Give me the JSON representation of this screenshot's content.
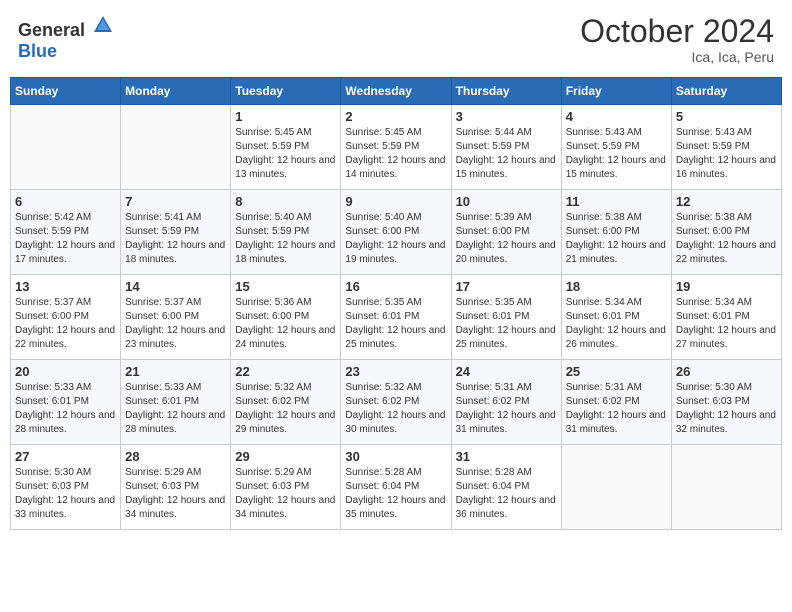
{
  "header": {
    "logo_general": "General",
    "logo_blue": "Blue",
    "month_year": "October 2024",
    "location": "Ica, Ica, Peru"
  },
  "weekdays": [
    "Sunday",
    "Monday",
    "Tuesday",
    "Wednesday",
    "Thursday",
    "Friday",
    "Saturday"
  ],
  "weeks": [
    [
      {
        "day": "",
        "sunrise": "",
        "sunset": "",
        "daylight": ""
      },
      {
        "day": "",
        "sunrise": "",
        "sunset": "",
        "daylight": ""
      },
      {
        "day": "1",
        "sunrise": "Sunrise: 5:45 AM",
        "sunset": "Sunset: 5:59 PM",
        "daylight": "Daylight: 12 hours and 13 minutes."
      },
      {
        "day": "2",
        "sunrise": "Sunrise: 5:45 AM",
        "sunset": "Sunset: 5:59 PM",
        "daylight": "Daylight: 12 hours and 14 minutes."
      },
      {
        "day": "3",
        "sunrise": "Sunrise: 5:44 AM",
        "sunset": "Sunset: 5:59 PM",
        "daylight": "Daylight: 12 hours and 15 minutes."
      },
      {
        "day": "4",
        "sunrise": "Sunrise: 5:43 AM",
        "sunset": "Sunset: 5:59 PM",
        "daylight": "Daylight: 12 hours and 15 minutes."
      },
      {
        "day": "5",
        "sunrise": "Sunrise: 5:43 AM",
        "sunset": "Sunset: 5:59 PM",
        "daylight": "Daylight: 12 hours and 16 minutes."
      }
    ],
    [
      {
        "day": "6",
        "sunrise": "Sunrise: 5:42 AM",
        "sunset": "Sunset: 5:59 PM",
        "daylight": "Daylight: 12 hours and 17 minutes."
      },
      {
        "day": "7",
        "sunrise": "Sunrise: 5:41 AM",
        "sunset": "Sunset: 5:59 PM",
        "daylight": "Daylight: 12 hours and 18 minutes."
      },
      {
        "day": "8",
        "sunrise": "Sunrise: 5:40 AM",
        "sunset": "Sunset: 5:59 PM",
        "daylight": "Daylight: 12 hours and 18 minutes."
      },
      {
        "day": "9",
        "sunrise": "Sunrise: 5:40 AM",
        "sunset": "Sunset: 6:00 PM",
        "daylight": "Daylight: 12 hours and 19 minutes."
      },
      {
        "day": "10",
        "sunrise": "Sunrise: 5:39 AM",
        "sunset": "Sunset: 6:00 PM",
        "daylight": "Daylight: 12 hours and 20 minutes."
      },
      {
        "day": "11",
        "sunrise": "Sunrise: 5:38 AM",
        "sunset": "Sunset: 6:00 PM",
        "daylight": "Daylight: 12 hours and 21 minutes."
      },
      {
        "day": "12",
        "sunrise": "Sunrise: 5:38 AM",
        "sunset": "Sunset: 6:00 PM",
        "daylight": "Daylight: 12 hours and 22 minutes."
      }
    ],
    [
      {
        "day": "13",
        "sunrise": "Sunrise: 5:37 AM",
        "sunset": "Sunset: 6:00 PM",
        "daylight": "Daylight: 12 hours and 22 minutes."
      },
      {
        "day": "14",
        "sunrise": "Sunrise: 5:37 AM",
        "sunset": "Sunset: 6:00 PM",
        "daylight": "Daylight: 12 hours and 23 minutes."
      },
      {
        "day": "15",
        "sunrise": "Sunrise: 5:36 AM",
        "sunset": "Sunset: 6:00 PM",
        "daylight": "Daylight: 12 hours and 24 minutes."
      },
      {
        "day": "16",
        "sunrise": "Sunrise: 5:35 AM",
        "sunset": "Sunset: 6:01 PM",
        "daylight": "Daylight: 12 hours and 25 minutes."
      },
      {
        "day": "17",
        "sunrise": "Sunrise: 5:35 AM",
        "sunset": "Sunset: 6:01 PM",
        "daylight": "Daylight: 12 hours and 25 minutes."
      },
      {
        "day": "18",
        "sunrise": "Sunrise: 5:34 AM",
        "sunset": "Sunset: 6:01 PM",
        "daylight": "Daylight: 12 hours and 26 minutes."
      },
      {
        "day": "19",
        "sunrise": "Sunrise: 5:34 AM",
        "sunset": "Sunset: 6:01 PM",
        "daylight": "Daylight: 12 hours and 27 minutes."
      }
    ],
    [
      {
        "day": "20",
        "sunrise": "Sunrise: 5:33 AM",
        "sunset": "Sunset: 6:01 PM",
        "daylight": "Daylight: 12 hours and 28 minutes."
      },
      {
        "day": "21",
        "sunrise": "Sunrise: 5:33 AM",
        "sunset": "Sunset: 6:01 PM",
        "daylight": "Daylight: 12 hours and 28 minutes."
      },
      {
        "day": "22",
        "sunrise": "Sunrise: 5:32 AM",
        "sunset": "Sunset: 6:02 PM",
        "daylight": "Daylight: 12 hours and 29 minutes."
      },
      {
        "day": "23",
        "sunrise": "Sunrise: 5:32 AM",
        "sunset": "Sunset: 6:02 PM",
        "daylight": "Daylight: 12 hours and 30 minutes."
      },
      {
        "day": "24",
        "sunrise": "Sunrise: 5:31 AM",
        "sunset": "Sunset: 6:02 PM",
        "daylight": "Daylight: 12 hours and 31 minutes."
      },
      {
        "day": "25",
        "sunrise": "Sunrise: 5:31 AM",
        "sunset": "Sunset: 6:02 PM",
        "daylight": "Daylight: 12 hours and 31 minutes."
      },
      {
        "day": "26",
        "sunrise": "Sunrise: 5:30 AM",
        "sunset": "Sunset: 6:03 PM",
        "daylight": "Daylight: 12 hours and 32 minutes."
      }
    ],
    [
      {
        "day": "27",
        "sunrise": "Sunrise: 5:30 AM",
        "sunset": "Sunset: 6:03 PM",
        "daylight": "Daylight: 12 hours and 33 minutes."
      },
      {
        "day": "28",
        "sunrise": "Sunrise: 5:29 AM",
        "sunset": "Sunset: 6:03 PM",
        "daylight": "Daylight: 12 hours and 34 minutes."
      },
      {
        "day": "29",
        "sunrise": "Sunrise: 5:29 AM",
        "sunset": "Sunset: 6:03 PM",
        "daylight": "Daylight: 12 hours and 34 minutes."
      },
      {
        "day": "30",
        "sunrise": "Sunrise: 5:28 AM",
        "sunset": "Sunset: 6:04 PM",
        "daylight": "Daylight: 12 hours and 35 minutes."
      },
      {
        "day": "31",
        "sunrise": "Sunrise: 5:28 AM",
        "sunset": "Sunset: 6:04 PM",
        "daylight": "Daylight: 12 hours and 36 minutes."
      },
      {
        "day": "",
        "sunrise": "",
        "sunset": "",
        "daylight": ""
      },
      {
        "day": "",
        "sunrise": "",
        "sunset": "",
        "daylight": ""
      }
    ]
  ]
}
